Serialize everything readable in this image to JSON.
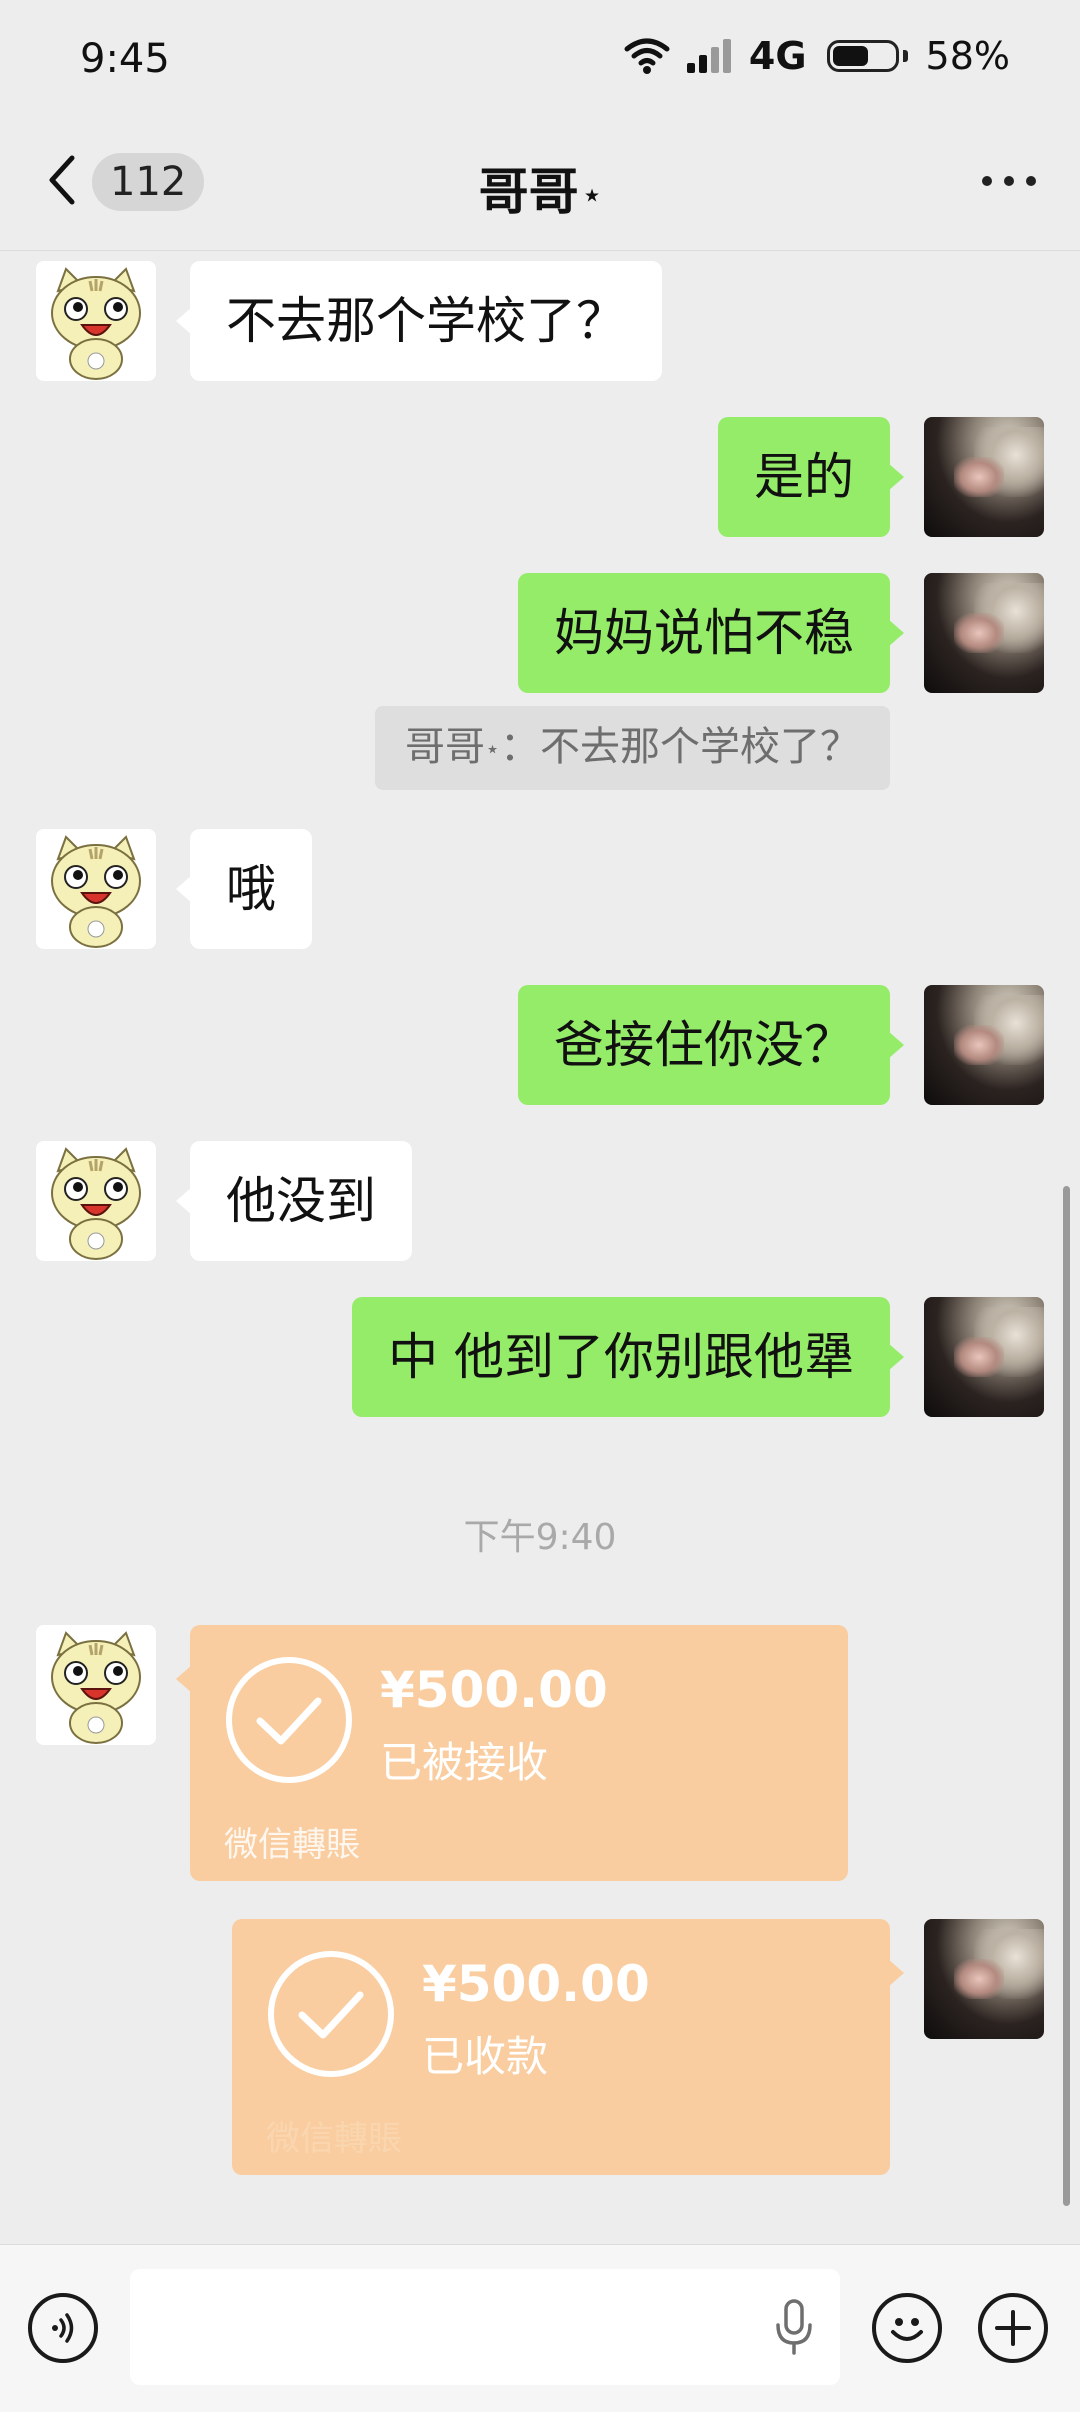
{
  "status_bar": {
    "time": "9:45",
    "network": "4G",
    "battery_percent": "58%",
    "battery_level": 0.58
  },
  "nav": {
    "unread_count": "112",
    "title": "哥哥",
    "title_mark": "⋆"
  },
  "messages": [
    {
      "side": "left",
      "text": "不去那个学校了？"
    },
    {
      "side": "right",
      "text": "是的"
    },
    {
      "side": "right",
      "text": "妈妈说怕不稳"
    },
    {
      "side": "right",
      "text": "爸接住你没？"
    },
    {
      "side": "left",
      "text": "哦"
    },
    {
      "side": "left",
      "text": "他没到"
    },
    {
      "side": "right",
      "text": "中 他到了你别跟他犟"
    }
  ],
  "quote": {
    "sender": "哥哥",
    "mark": "⋆",
    "text": "：不去那个学校了？"
  },
  "timestamp": "下午9:40",
  "transfers": [
    {
      "side": "left",
      "amount": "¥500.00",
      "status": "已被接收",
      "source": "微信轉賬"
    },
    {
      "side": "right",
      "amount": "¥500.00",
      "status": "已收款",
      "source": "微信轉賬"
    }
  ],
  "icons": {
    "back": "chevron-left-icon",
    "more": "more-dots-icon",
    "voice": "voice-icon",
    "mic": "mic-icon",
    "emoji": "emoji-icon",
    "plus": "plus-icon"
  },
  "colors": {
    "sent_bubble": "#95ec69",
    "received_bubble": "#ffffff",
    "transfer_card": "#f9cd9f",
    "background": "#ededed"
  }
}
